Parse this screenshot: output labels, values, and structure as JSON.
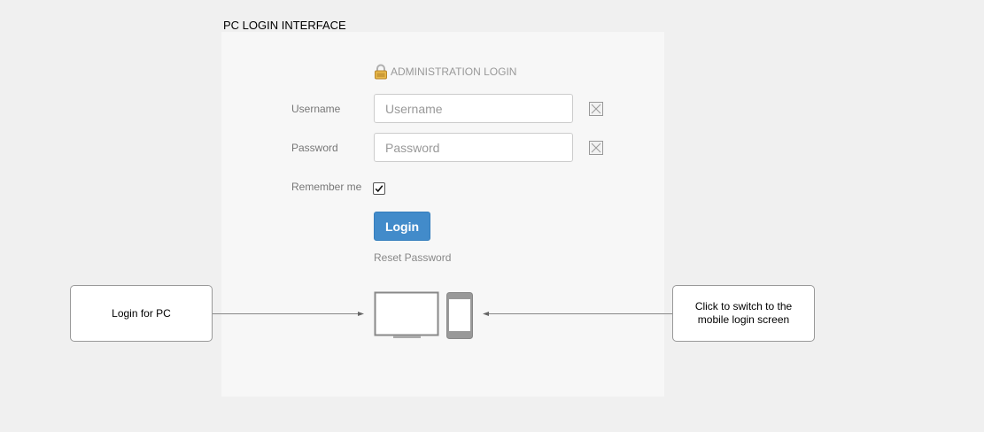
{
  "page_title": "PC LOGIN INTERFACE",
  "form": {
    "heading": "ADMINISTRATION LOGIN",
    "heading_icon": "lock-icon",
    "username": {
      "label": "Username",
      "placeholder": "Username",
      "value": ""
    },
    "password": {
      "label": "Password",
      "placeholder": "Password",
      "value": ""
    },
    "clear_icon": "clear-field-icon",
    "remember": {
      "label": "Remember me",
      "checked": true
    },
    "login_label": "Login",
    "reset_label": "Reset Password",
    "accent_color": "#428bca"
  },
  "devices": {
    "desktop_icon": "monitor-icon",
    "mobile_icon": "smartphone-icon"
  },
  "annotations": {
    "left_note": "Login for PC",
    "right_note": "Click to switch to the mobile login screen"
  }
}
